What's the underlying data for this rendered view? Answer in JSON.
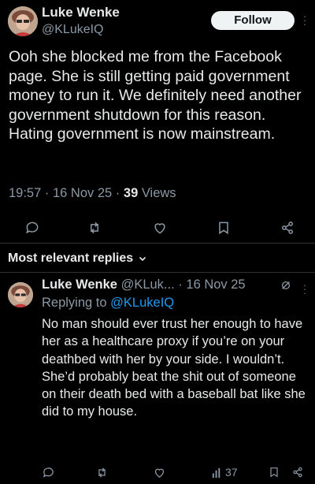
{
  "post": {
    "author_name": "Luke Wenke",
    "author_handle": "@KLukeIQ",
    "follow_label": "Follow",
    "text": "Ooh she blocked me from the Facebook page.  She is still getting paid government money to run it.  We definitely need another government shutdown for this reason.  Hating government is now mainstream.",
    "time": "19:57",
    "date": "16 Nov 25",
    "views_count": "39",
    "views_label": "Views",
    "actions": [
      "reply-icon",
      "repost-icon",
      "like-icon",
      "bookmark-icon",
      "share-icon"
    ]
  },
  "replies_section": {
    "label": "Most relevant replies",
    "icon": "chevron-down-icon"
  },
  "reply": {
    "author_name": "Luke Wenke",
    "author_handle": "@KLuk...",
    "date": "16 Nov 25",
    "replying_prefix": "Replying to",
    "replying_to": "@KLukeIQ",
    "text": "No man should ever trust her enough to have her as a healthcare proxy if you’re on your deathbed with her by your side.  I wouldn’t.  She’d probably beat the shit out of someone on their death bed with a baseball bat like she did to my house.",
    "views_count": "37",
    "icons": [
      "grok-icon",
      "more-icon",
      "reply-icon",
      "repost-icon",
      "like-icon",
      "analytics-icon",
      "bookmark-icon",
      "share-icon"
    ]
  },
  "colors": {
    "background": "#000000",
    "text": "#e7e9ea",
    "secondary": "#8b98a5",
    "link": "#1d9bf0",
    "divider": "#2f3336"
  }
}
